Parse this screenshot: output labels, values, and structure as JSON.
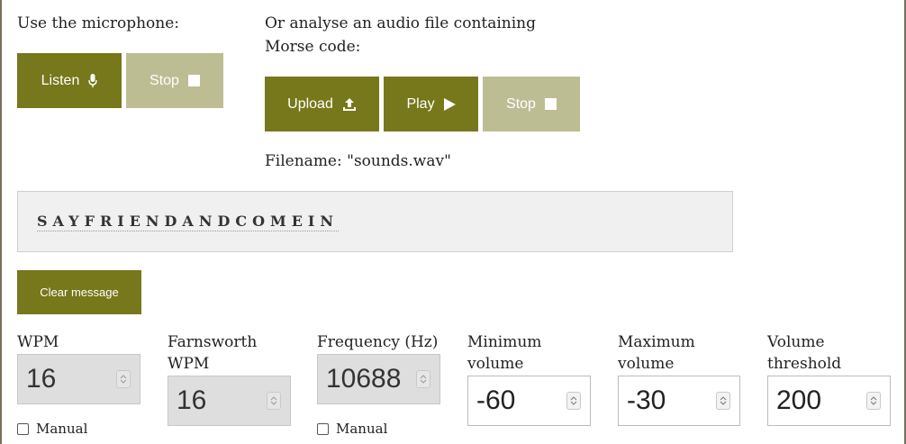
{
  "mic": {
    "heading": "Use the microphone:",
    "listen_label": "Listen",
    "stop_label": "Stop"
  },
  "file": {
    "heading": "Or analyse an audio file containing Morse code:",
    "upload_label": "Upload",
    "play_label": "Play",
    "stop_label": "Stop",
    "filename_text": "Filename: \"sounds.wav\""
  },
  "message": {
    "text": "SAYFRIENDANDCOMEIN",
    "clear_label": "Clear message"
  },
  "settings": {
    "wpm": {
      "label": "WPM",
      "value": "16",
      "manual_label": "Manual"
    },
    "farnsworth": {
      "label": "Farnsworth WPM",
      "value": "16"
    },
    "frequency": {
      "label": "Frequency (Hz)",
      "value": "10688",
      "manual_label": "Manual"
    },
    "min_volume": {
      "label": "Minimum volume",
      "value": "-60"
    },
    "max_volume": {
      "label": "Maximum volume",
      "value": "-30"
    },
    "threshold": {
      "label": "Volume threshold",
      "value": "200"
    }
  },
  "colors": {
    "button_active": "#77771b",
    "button_disabled": "#bdbd93",
    "message_bg": "#f0f0f0"
  }
}
